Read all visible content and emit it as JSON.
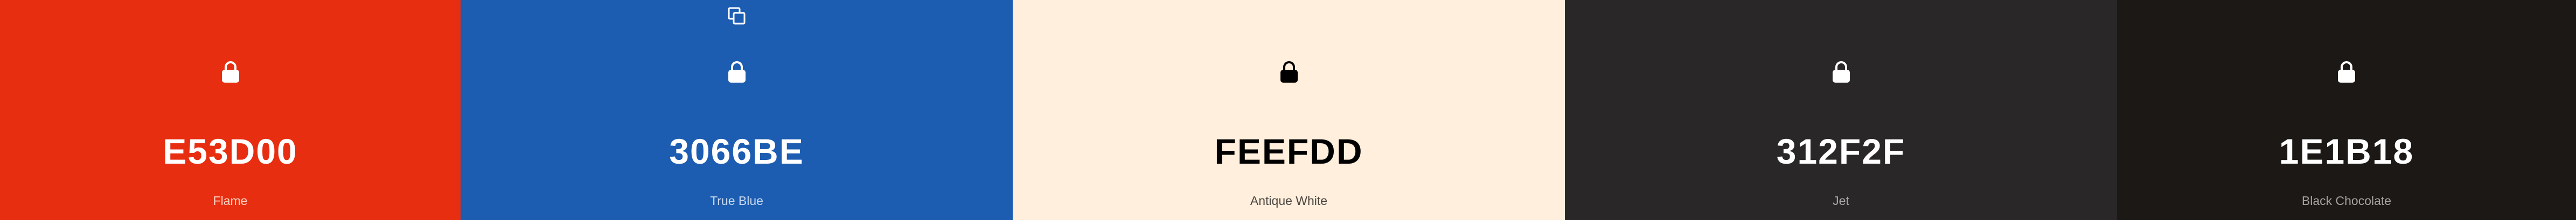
{
  "palette": {
    "colors": [
      {
        "hex": "E53D00",
        "name": "Flame",
        "bg": "#E82E10",
        "fg": "#FFFFFF",
        "sub": "#FFD2C4",
        "icon": "lock-icon"
      },
      {
        "hex": "3066BE",
        "name": "True Blue",
        "bg": "#1C5DB2",
        "fg": "#FFFFFF",
        "sub": "#C8D8F0",
        "icon": "lock-icon"
      },
      {
        "hex": "FEEFDD",
        "name": "Antique White",
        "bg": "#FFEFDC",
        "fg": "#000000",
        "sub": "#4A4540",
        "icon": "lock-icon"
      },
      {
        "hex": "312F2F",
        "name": "Jet",
        "bg": "#292727",
        "fg": "#FFFFFF",
        "sub": "#A9A6A6",
        "icon": "lock-icon"
      },
      {
        "hex": "1E1B18",
        "name": "Black Chocolate",
        "bg": "#1B1815",
        "fg": "#FFFFFF",
        "sub": "#A8A39E",
        "icon": "lock-icon"
      }
    ],
    "toolbar_icon": "copy-icon"
  }
}
